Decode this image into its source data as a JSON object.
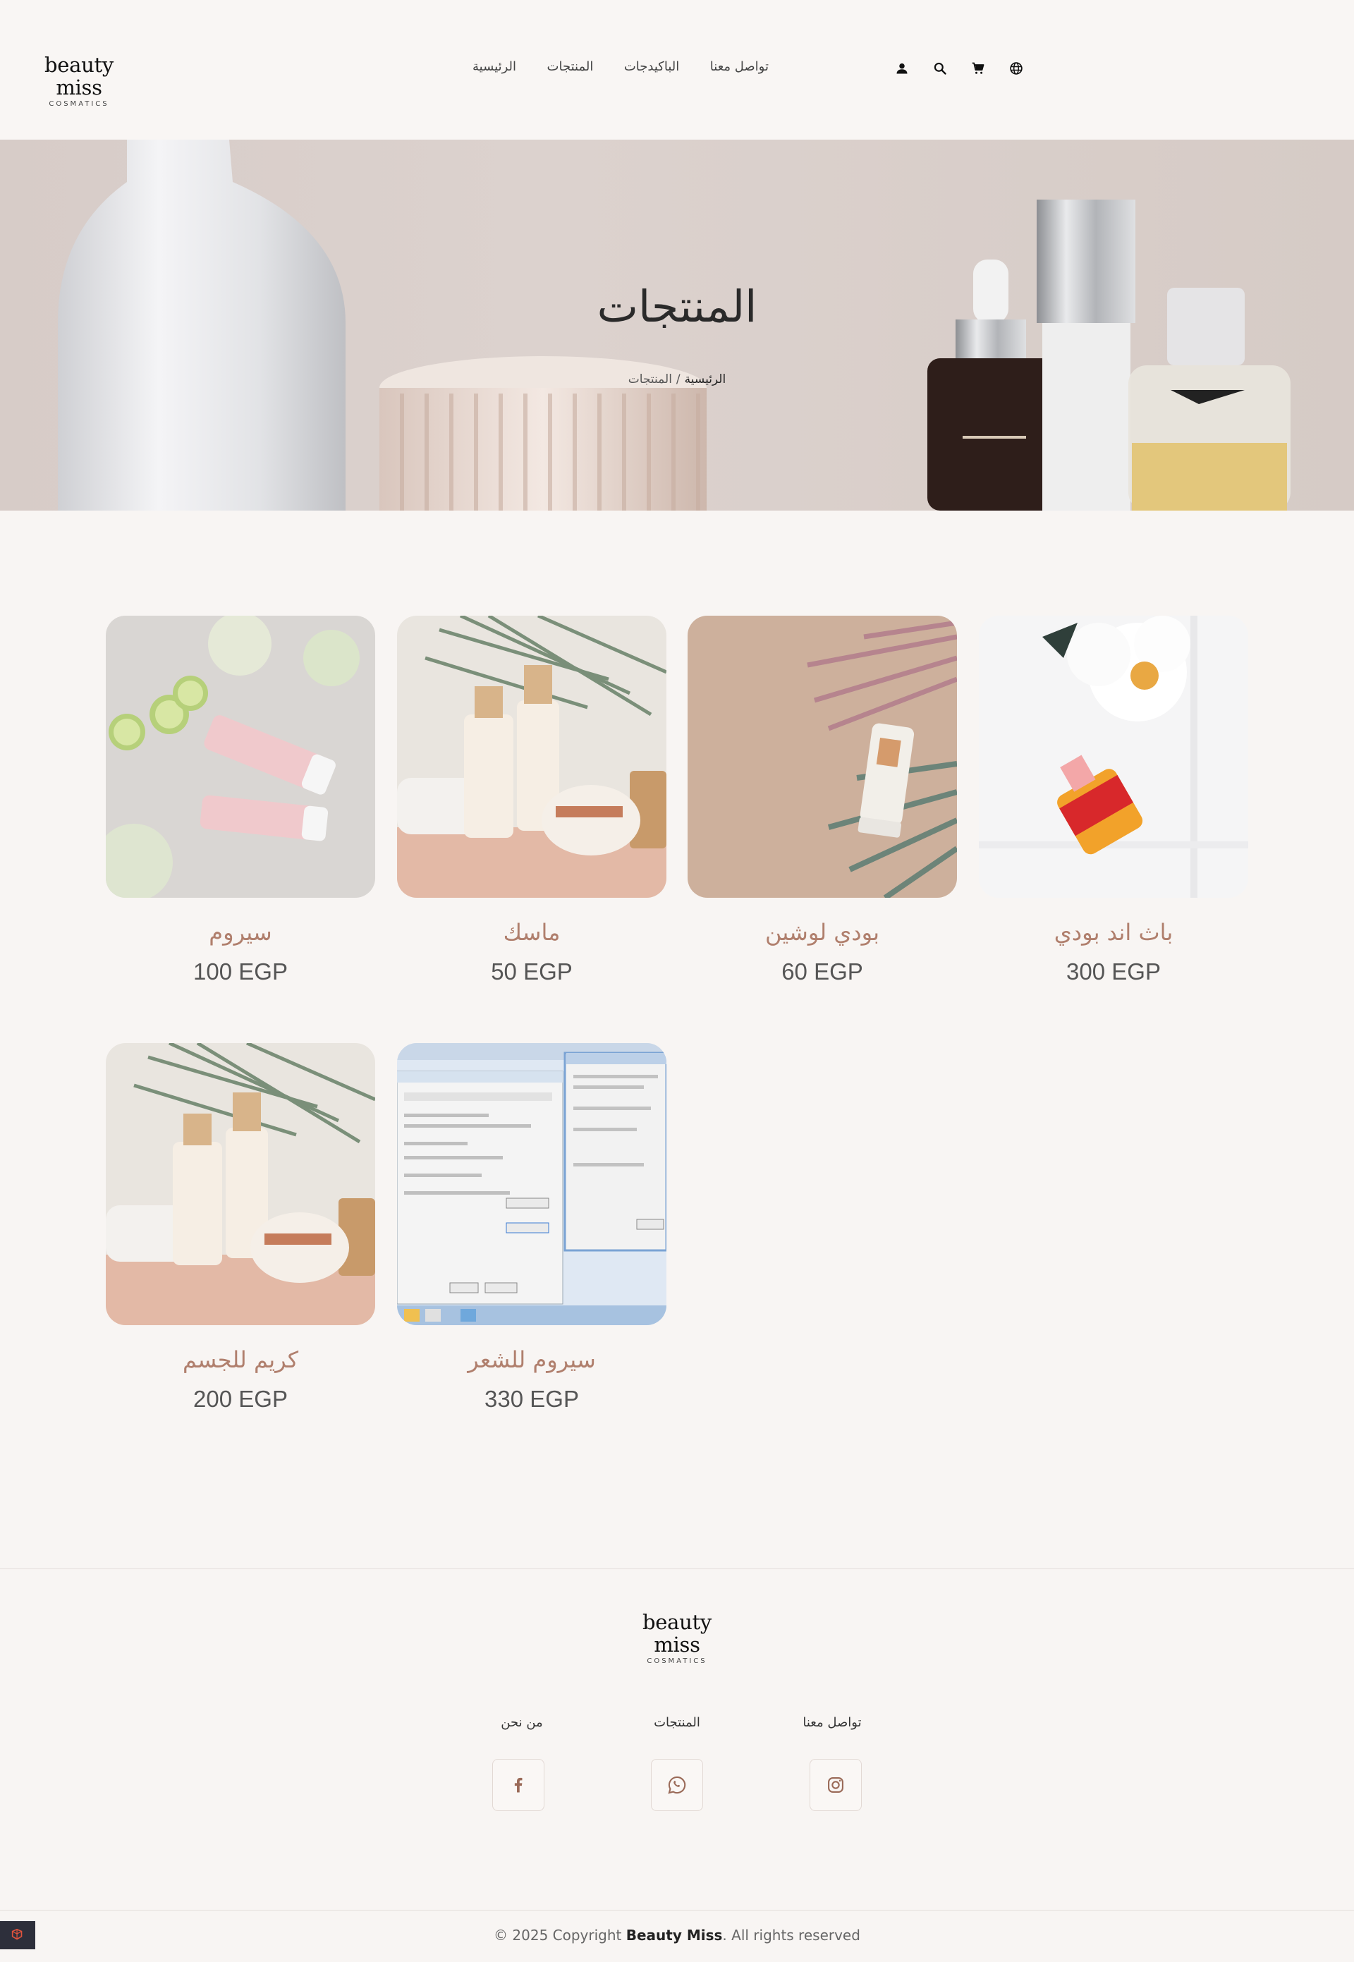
{
  "brand": {
    "name": "beauty miss",
    "tagline": "COSMATICS"
  },
  "nav": {
    "home": "الرئيسية",
    "products": "المنتجات",
    "packages": "الباكيدجات",
    "contact": "تواصل معنا"
  },
  "header_icons": [
    "user-icon",
    "search-icon",
    "cart-icon",
    "language-icon"
  ],
  "hero": {
    "title": "المنتجات",
    "breadcrumb_home": "الرئيسية",
    "breadcrumb_sep": "/",
    "breadcrumb_current": "المنتجات"
  },
  "products": [
    {
      "name": "سيروم",
      "price": "100 EGP"
    },
    {
      "name": "ماسك",
      "price": "50 EGP"
    },
    {
      "name": "بودي لوشين",
      "price": "60 EGP"
    },
    {
      "name": "باث اند بودي",
      "price": "300 EGP"
    },
    {
      "name": "كريم للجسم",
      "price": "200 EGP"
    },
    {
      "name": "سيروم للشعر",
      "price": "330 EGP"
    }
  ],
  "footer": {
    "brand_name": "beauty miss",
    "brand_tagline": "COSMATICS",
    "links": {
      "about": "من نحن",
      "products": "المنتجات",
      "contact": "تواصل معنا"
    },
    "socials": [
      "facebook-icon",
      "whatsapp-icon",
      "instagram-icon"
    ],
    "copyright_prefix": "© 2025 Copyright",
    "copyright_brand": "Beauty Miss",
    "copyright_suffix": ". All rights reserved"
  },
  "colors": {
    "accent": "#b07f6d",
    "background": "#f8f5f3",
    "hero_bg": "#d7ccc8"
  }
}
